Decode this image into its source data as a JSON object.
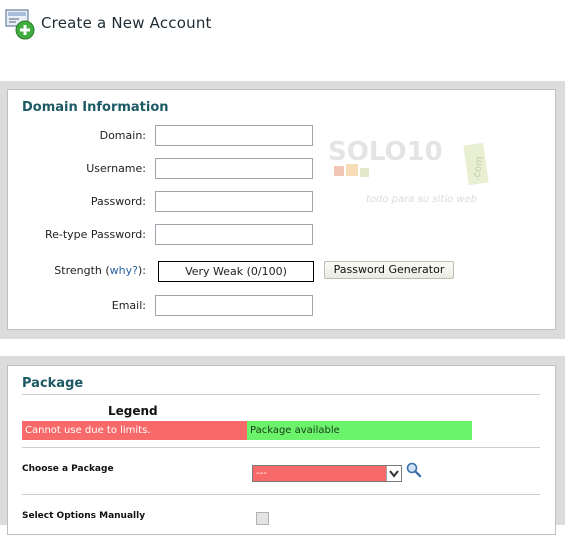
{
  "header": {
    "title": "Create a New Account",
    "icon": "add-account-icon"
  },
  "domain_section": {
    "title": "Domain Information",
    "fields": {
      "domain": {
        "label": "Domain:",
        "value": ""
      },
      "username": {
        "label": "Username:",
        "value": ""
      },
      "password": {
        "label": "Password:",
        "value": ""
      },
      "retype": {
        "label": "Re-type Password:",
        "value": ""
      },
      "email": {
        "label": "Email:",
        "value": ""
      }
    },
    "strength": {
      "label_prefix": "Strength (",
      "why_link": "why?",
      "label_suffix": "):",
      "value": "Very Weak (0/100)"
    },
    "password_generator_button": "Password Generator"
  },
  "watermark": {
    "brand": "SOLO10",
    "tld": ".com",
    "tagline": "todo para su sitio web"
  },
  "package_section": {
    "title": "Package",
    "legend": {
      "title": "Legend",
      "unavailable": "Cannot use due to limits.",
      "available": "Package available",
      "unavailable_color": "#f86a6a",
      "available_color": "#6cf36c"
    },
    "choose_label": "Choose a Package",
    "selected_package": "---",
    "manual_label": "Select Options Manually"
  }
}
